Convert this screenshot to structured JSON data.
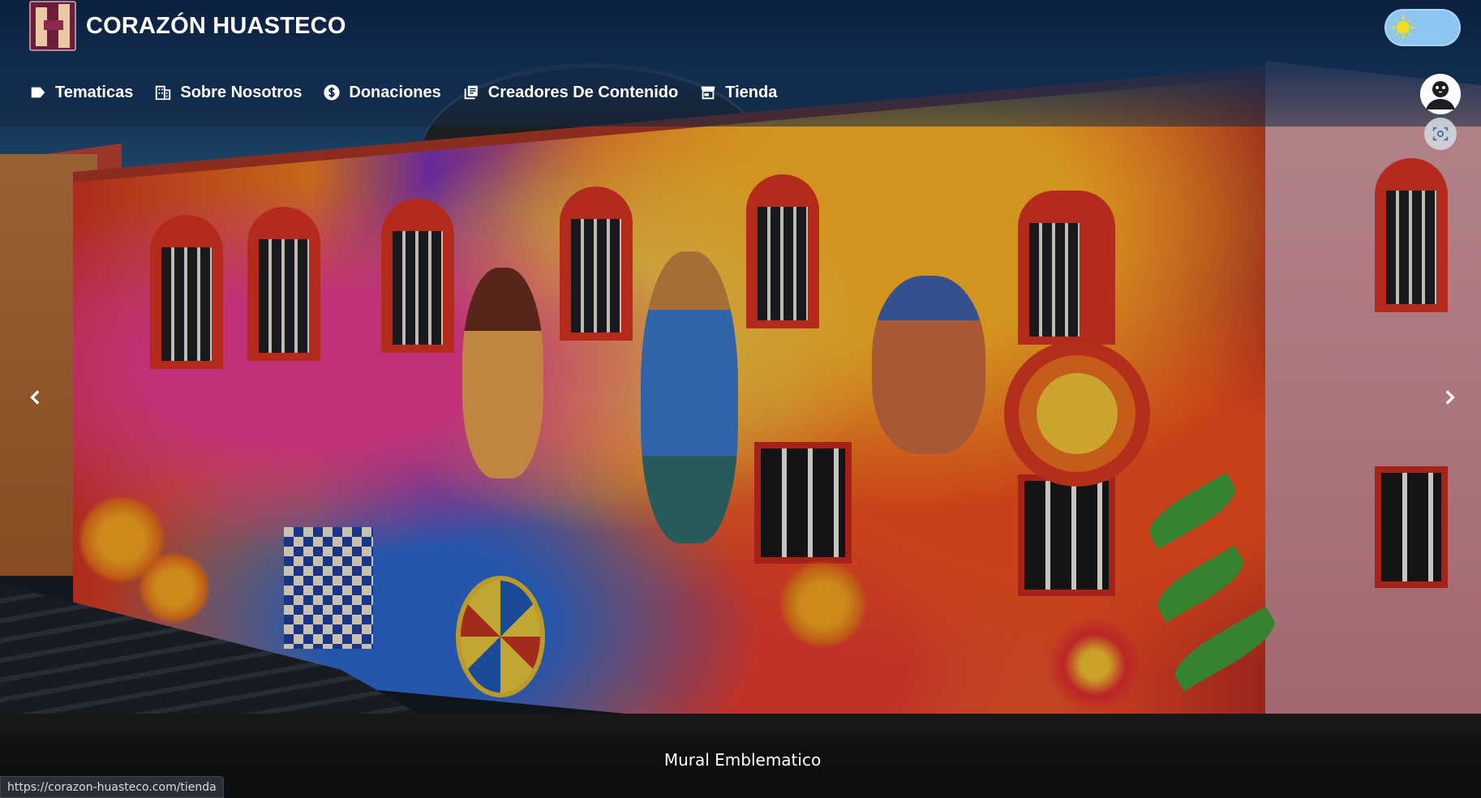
{
  "brand": {
    "title": "CORAZÓN HUASTECO",
    "logo_icon": "corazon-huasteco-logo"
  },
  "theme_toggle": {
    "icon": "sun-icon",
    "track_color": "#8ec5f1",
    "sun_color": "#f4e012"
  },
  "nav": {
    "items": [
      {
        "label": "Tematicas",
        "icon": "tag-icon"
      },
      {
        "label": "Sobre Nosotros",
        "icon": "building-icon"
      },
      {
        "label": "Donaciones",
        "icon": "dollar-coin-icon"
      },
      {
        "label": "Creadores De Contenido",
        "icon": "library-books-icon"
      },
      {
        "label": "Tienda",
        "icon": "storefront-icon"
      }
    ]
  },
  "account": {
    "icon": "user-avatar-icon"
  },
  "camera": {
    "icon": "camera-scan-icon"
  },
  "carousel": {
    "caption": "Mural Emblematico",
    "prev_icon": "chevron-left-icon",
    "next_icon": "chevron-right-icon"
  },
  "status_bar": {
    "url": "https://corazon-huasteco.com/tienda"
  },
  "colors": {
    "header_bg": "#0c2140",
    "text": "#ffffff"
  }
}
